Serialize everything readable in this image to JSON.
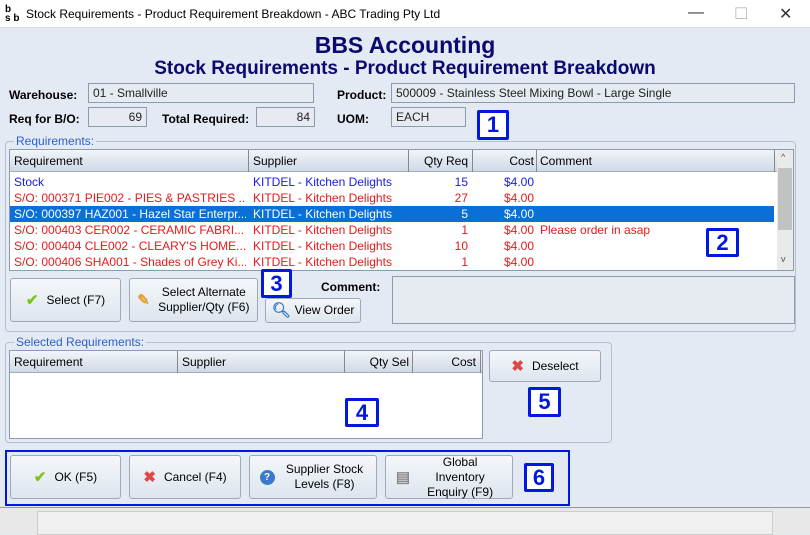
{
  "window": {
    "title": "Stock Requirements - Product Requirement Breakdown - ABC Trading Pty Ltd",
    "logo": "bbs",
    "minimize": "—",
    "maximize": "☐",
    "close": "✕"
  },
  "header": {
    "app": "BBS Accounting",
    "subtitle": "Stock Requirements - Product Requirement Breakdown"
  },
  "info": {
    "warehouse_label": "Warehouse:",
    "warehouse": "01 - Smallville",
    "product_label": "Product:",
    "product": "500009 - Stainless Steel Mixing Bowl - Large Single",
    "reqbo_label": "Req for B/O:",
    "reqbo": "69",
    "total_label": "Total Required:",
    "total": "84",
    "uom_label": "UOM:",
    "uom": "EACH"
  },
  "requirements": {
    "title": "Requirements:",
    "columns": [
      "Requirement",
      "Supplier",
      "Qty Req",
      "Cost",
      "Comment"
    ],
    "rows": [
      {
        "req": "Stock",
        "supplier": "KITDEL - Kitchen Delights",
        "qty": "15",
        "cost": "$4.00",
        "comment": "",
        "color": "#1a1ae6"
      },
      {
        "req": "S/O: 000371 PIE002 - PIES & PASTRIES ...",
        "supplier": "KITDEL - Kitchen Delights",
        "qty": "27",
        "cost": "$4.00",
        "comment": "",
        "color": "#e61a1a"
      },
      {
        "req": "S/O: 000397 HAZ001 - Hazel Star Enterpr...",
        "supplier": "KITDEL - Kitchen Delights",
        "qty": "5",
        "cost": "$4.00",
        "comment": "",
        "color": "#ffffff",
        "selected": true
      },
      {
        "req": "S/O: 000403 CER002 - CERAMIC FABRI...",
        "supplier": "KITDEL - Kitchen Delights",
        "qty": "1",
        "cost": "$4.00",
        "comment": "Please order in asap",
        "color": "#e61a1a"
      },
      {
        "req": "S/O: 000404 CLE002 - CLEARY'S HOME...",
        "supplier": "KITDEL - Kitchen Delights",
        "qty": "10",
        "cost": "$4.00",
        "comment": "",
        "color": "#e61a1a"
      },
      {
        "req": "S/O: 000406 SHA001 - Shades of Grey Ki...",
        "supplier": "KITDEL - Kitchen Delights",
        "qty": "1",
        "cost": "$4.00",
        "comment": "",
        "color": "#e61a1a"
      }
    ]
  },
  "actions": {
    "select": "Select (F7)",
    "alternate": "Select Alternate Supplier/Qty (F6)",
    "view_order": "View Order",
    "comment_label": "Comment:",
    "comment_value": ""
  },
  "selected": {
    "title": "Selected Requirements:",
    "columns": [
      "Requirement",
      "Supplier",
      "Qty Sel",
      "Cost"
    ],
    "deselect": "Deselect"
  },
  "footer": {
    "ok": "OK (F5)",
    "cancel": "Cancel (F4)",
    "supplier_stock": "Supplier Stock Levels (F8)",
    "global_inventory": "Global Inventory Enquiry (F9)"
  },
  "badges": [
    "1",
    "2",
    "3",
    "4",
    "5",
    "6"
  ]
}
